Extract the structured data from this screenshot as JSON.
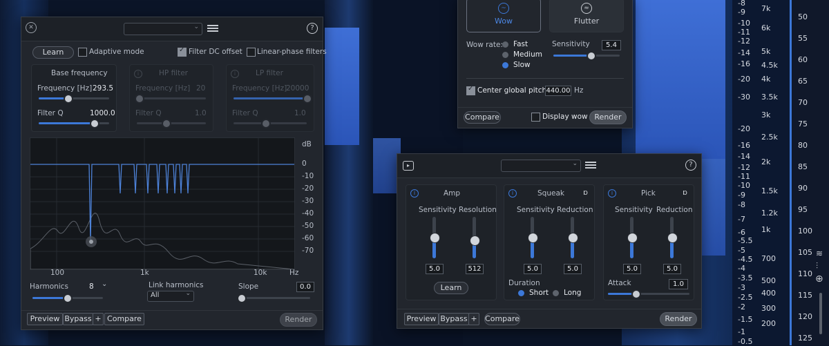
{
  "colors": {
    "accent": "#3c78d8",
    "panel": "#22262d",
    "waveform": "#3f6fd6"
  },
  "eq_panel": {
    "title_icon": "filter-plugin-icon",
    "learn_label": "Learn",
    "adaptive_mode_label": "Adaptive mode",
    "filter_dc_offset_label": "Filter DC offset",
    "linear_phase_label": "Linear-phase filters",
    "base_frequency_title": "Base frequency",
    "hp_filter_title": "HP filter",
    "lp_filter_title": "LP filter",
    "frequency_label": "Frequency [Hz]",
    "frequency_hz_label": "Frequency [Hz]",
    "base_freq_value": "293.5",
    "hp_freq_value": "20",
    "lp_freq_value": "20000",
    "filter_q_label": "Filter Q",
    "base_q_value": "1000.0",
    "hp_q_value": "1.0",
    "lp_q_value": "1.0",
    "db_label": "dB",
    "db_ticks": [
      "0",
      "-10",
      "-20",
      "-30",
      "-40",
      "-50",
      "-60",
      "-70"
    ],
    "freq_ticks": [
      "100",
      "1k",
      "10k",
      "Hz"
    ],
    "harmonics_label": "Harmonics",
    "harmonics_value": "8",
    "link_harmonics_label": "Link harmonics",
    "link_harmonics_value": "All",
    "slope_label": "Slope",
    "slope_value": "0.0",
    "preview_label": "Preview",
    "bypass_label": "Bypass",
    "plus_label": "+",
    "compare_label": "Compare",
    "render_label": "Render"
  },
  "wow_panel": {
    "wow_tab": "Wow",
    "flutter_tab": "Flutter",
    "wow_rate_label": "Wow rate:",
    "rates": [
      "Fast",
      "Medium",
      "Slow"
    ],
    "selected_rate": "Slow",
    "sensitivity_label": "Sensitivity",
    "sensitivity_value": "5.4",
    "center_pitch_label": "Center global pitch to",
    "center_pitch_value": "440.00",
    "center_pitch_unit": "Hz",
    "compare_label": "Compare",
    "display_wow_label": "Display wow",
    "render_label": "Render"
  },
  "declick_panel": {
    "amp": {
      "title": "Amp",
      "sensitivity_label": "Sensitivity",
      "resolution_label": "Resolution",
      "sensitivity_value": "5.0",
      "resolution_value": "512",
      "learn_label": "Learn"
    },
    "squeak": {
      "title": "Squeak",
      "sensitivity_label": "Sensitivity",
      "reduction_label": "Reduction",
      "sensitivity_value": "5.0",
      "reduction_value": "5.0",
      "duration_label": "Duration",
      "short_label": "Short",
      "long_label": "Long"
    },
    "pick": {
      "title": "Pick",
      "sensitivity_label": "Sensitivity",
      "reduction_label": "Reduction",
      "sensitivity_value": "5.0",
      "reduction_value": "5.0",
      "attack_label": "Attack",
      "attack_value": "1.0"
    },
    "preview_label": "Preview",
    "bypass_label": "Bypass",
    "plus_label": "+",
    "compare_label": "Compare",
    "render_label": "Render"
  },
  "db_scale": [
    "-8",
    "-9",
    "-10",
    "-11",
    "-12",
    "-14",
    "-16",
    "-20",
    "-30",
    "-30",
    "-20",
    "-16",
    "-14",
    "-12",
    "-11",
    "-10",
    "-9",
    "-8",
    "-7",
    "-6",
    "-5.5",
    "-5",
    "-4.5",
    "-4",
    "-3.5",
    "-3",
    "-2.5",
    "-2",
    "-1.5",
    "-1",
    "-0.5"
  ],
  "hz_scale": [
    "7k",
    "6k",
    "5k",
    "4.5k",
    "4k",
    "3.5k",
    "3k",
    "2.5k",
    "2k",
    "1.5k",
    "1.2k",
    "1k",
    "700",
    "500",
    "400",
    "300",
    "200"
  ],
  "right_scale": [
    "50",
    "55",
    "60",
    "65",
    "70",
    "75",
    "80",
    "85",
    "90",
    "95",
    "100",
    "105",
    "110",
    "115",
    "120",
    "125"
  ]
}
